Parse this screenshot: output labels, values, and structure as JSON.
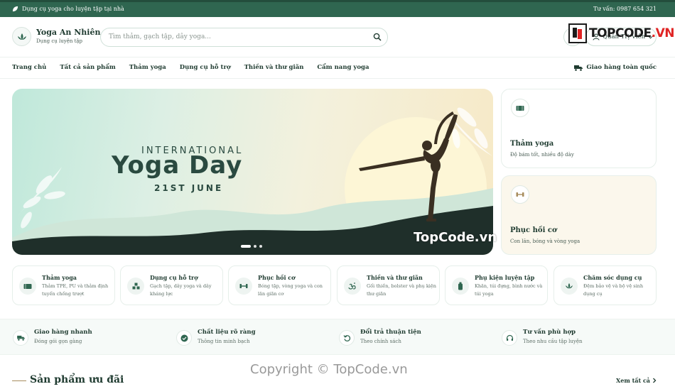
{
  "topbar": {
    "promo": "Dụng cụ yoga cho luyện tập tại nhà",
    "hotline": "Tư vấn: 0987 654 321"
  },
  "brand": {
    "name": "Yoga An Nhiên",
    "tagline": "Dụng cụ luyện tập",
    "accent": "#2f6650",
    "gold": "#a88d5e"
  },
  "search": {
    "placeholder": "Tìm thảm, gạch tập, dây yoga..."
  },
  "cart": {
    "count": "0"
  },
  "account": {
    "label": "Quản Trị Viên"
  },
  "watermark_logo": {
    "prefix": "TOPCODE",
    "suffix": ".VN"
  },
  "nav": {
    "items": [
      "Trang chủ",
      "Tất cả sản phẩm",
      "Thảm yoga",
      "Dụng cụ hỗ trợ",
      "Thiền và thư giãn",
      "Cẩm nang yoga"
    ],
    "shipping": "Giao hàng toàn quốc"
  },
  "hero": {
    "line1": "INTERNATIONAL",
    "line2": "Yoga Day",
    "line3": "21ST JUNE",
    "active_slide": 1,
    "slide_count": 3,
    "watermark": "TopCode.vn"
  },
  "side_cards": [
    {
      "title": "Thảm yoga",
      "desc": "Độ bám tốt, nhiều độ dày",
      "icon": "mat-icon"
    },
    {
      "title": "Phục hồi cơ",
      "desc": "Con lăn, bóng và vòng yoga",
      "icon": "dumbbell-icon"
    }
  ],
  "categories": [
    {
      "title": "Thảm yoga",
      "desc": "Thảm TPE, PU và thảm định tuyến chống trượt",
      "icon": "mat-icon"
    },
    {
      "title": "Dụng cụ hỗ trợ",
      "desc": "Gạch tập, dây yoga và dây kháng lực",
      "icon": "blocks-icon"
    },
    {
      "title": "Phục hồi cơ",
      "desc": "Bóng tập, vòng yoga và con lăn giãn cơ",
      "icon": "dumbbell-icon"
    },
    {
      "title": "Thiền và thư giãn",
      "desc": "Gối thiền, bolster và phụ kiện thư giãn",
      "icon": "om-icon"
    },
    {
      "title": "Phụ kiện luyện tập",
      "desc": "Khăn, túi đựng, bình nước và túi yoga",
      "icon": "bottle-icon"
    },
    {
      "title": "Chăm sóc dụng cụ",
      "desc": "Đệm bảo vệ và bộ vệ sinh dụng cụ",
      "icon": "lotus-icon"
    }
  ],
  "features": [
    {
      "title": "Giao hàng nhanh",
      "desc": "Đóng gói gọn gàng",
      "icon": "truck-icon"
    },
    {
      "title": "Chất liệu rõ ràng",
      "desc": "Thông tin minh bạch",
      "icon": "check-badge-icon"
    },
    {
      "title": "Đổi trả thuận tiện",
      "desc": "Theo chính sách",
      "icon": "return-icon"
    },
    {
      "title": "Tư vấn phù hợp",
      "desc": "Theo nhu cầu tập luyện",
      "icon": "headset-icon"
    }
  ],
  "section": {
    "title": "Sản phẩm ưu đãi",
    "see_all": "Xem tất cả"
  },
  "copyright_watermark": "Copyright © TopCode.vn"
}
